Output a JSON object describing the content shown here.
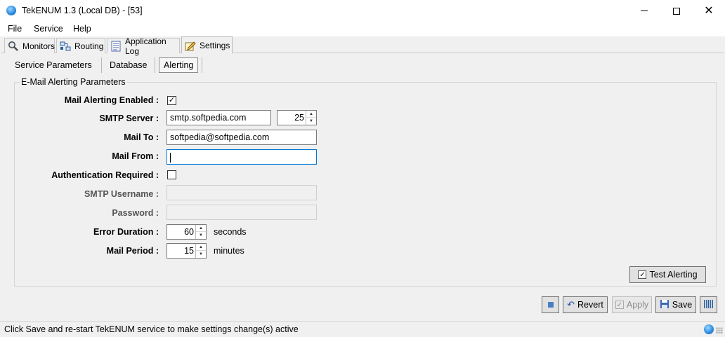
{
  "window": {
    "title": "TekENUM 1.3 (Local DB) - [53]"
  },
  "menu": [
    "File",
    "Service",
    "Help"
  ],
  "main_tabs": [
    {
      "label": "Monitors",
      "icon": "magnifier-icon"
    },
    {
      "label": "Routing",
      "icon": "routing-icon"
    },
    {
      "label": "Application Log",
      "icon": "log-icon"
    },
    {
      "label": "Settings",
      "icon": "settings-icon",
      "active": true
    }
  ],
  "sub_tabs": [
    {
      "label": "Service Parameters"
    },
    {
      "label": "Database"
    },
    {
      "label": "Alerting",
      "active": true
    }
  ],
  "group": {
    "title": "E-Mail Alerting Parameters",
    "fields": {
      "mail_alerting_enabled": {
        "label": "Mail Alerting Enabled :",
        "checked": true,
        "check_glyph": "✓"
      },
      "smtp_server": {
        "label": "SMTP Server :",
        "value": "smtp.softpedia.com",
        "port": "25"
      },
      "mail_to": {
        "label": "Mail To :",
        "value": "softpedia@softpedia.com"
      },
      "mail_from": {
        "label": "Mail From :",
        "value": ""
      },
      "auth_required": {
        "label": "Authentication Required :",
        "checked": false
      },
      "smtp_username": {
        "label": "SMTP Username :",
        "value": ""
      },
      "password": {
        "label": "Password :",
        "value": ""
      },
      "error_duration": {
        "label": "Error Duration :",
        "value": "60",
        "unit": "seconds"
      },
      "mail_period": {
        "label": "Mail Period :",
        "value": "15",
        "unit": "minutes"
      }
    },
    "test_button": {
      "label": "Test Alerting",
      "check_glyph": "✓"
    }
  },
  "footer_buttons": {
    "revert": "Revert",
    "apply": "Apply",
    "save": "Save"
  },
  "status": {
    "text": "Click Save and re-start TekENUM service to make settings change(s) active"
  },
  "colors": {
    "accent": "#0078d7",
    "panel": "#f0f0f0"
  }
}
